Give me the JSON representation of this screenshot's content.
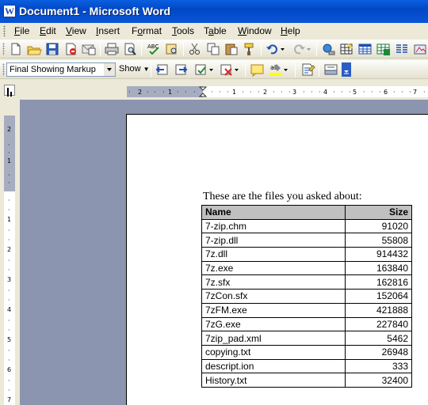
{
  "window": {
    "title": "Document1 - Microsoft Word"
  },
  "menu": [
    "File",
    "Edit",
    "View",
    "Insert",
    "Format",
    "Tools",
    "Table",
    "Window",
    "Help"
  ],
  "menu_access": [
    "F",
    "E",
    "V",
    "I",
    "o",
    "T",
    "a",
    "W",
    "H"
  ],
  "toolbar2": {
    "markup_mode": "Final Showing Markup",
    "show_label": "Show"
  },
  "document": {
    "intro": "These are the files you asked about:",
    "table": {
      "headers": [
        "Name",
        "Size"
      ],
      "rows": [
        [
          "7-zip.chm",
          "91020"
        ],
        [
          "7-zip.dll",
          "55808"
        ],
        [
          "7z.dll",
          "914432"
        ],
        [
          "7z.exe",
          "163840"
        ],
        [
          "7z.sfx",
          "162816"
        ],
        [
          "7zCon.sfx",
          "152064"
        ],
        [
          "7zFM.exe",
          "421888"
        ],
        [
          "7zG.exe",
          "227840"
        ],
        [
          "7zip_pad.xml",
          "5462"
        ],
        [
          "copying.txt",
          "26948"
        ],
        [
          "descript.ion",
          "333"
        ],
        [
          "History.txt",
          "32400"
        ]
      ]
    }
  },
  "colors": {
    "titlebar": "#0a5fe0",
    "doc_bg": "#8c95b0",
    "header_fill": "#c0c0c0"
  }
}
